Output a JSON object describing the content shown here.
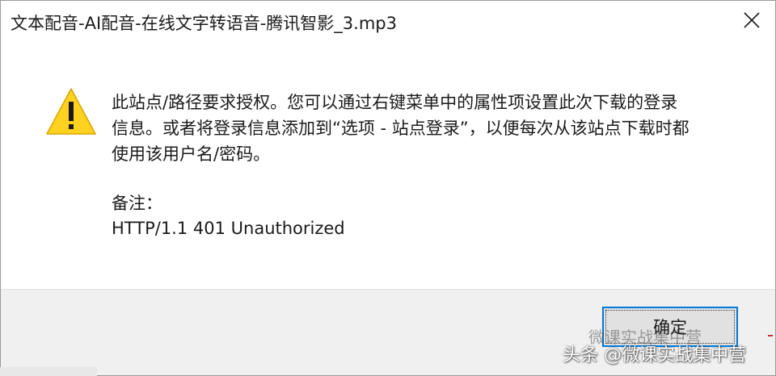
{
  "window": {
    "title": "文本配音-AI配音-在线文字转语音-腾讯智影_3.mp3"
  },
  "message": {
    "lines": [
      "此站点/路径要求授权。您可以通过右键菜单中的属性项设置此次下载的登录",
      "信息。或者将登录信息添加到“选项 - 站点登录”，以便每次从该站点下载时都",
      "使用该用户名/密码。"
    ],
    "note_label": "备注：",
    "note_value": "HTTP/1.1 401 Unauthorized"
  },
  "footer": {
    "ok_label": "确定"
  },
  "watermark": {
    "text": "头条 @微课实战集中营",
    "faint_text": "微课实战集中营"
  },
  "icons": {
    "warning": "warning-triangle-icon",
    "close": "close-icon"
  },
  "colors": {
    "warning_fill": "#ffd21f",
    "button_focus_border": "#0078d7",
    "footer_bg": "#f0f0f0"
  }
}
